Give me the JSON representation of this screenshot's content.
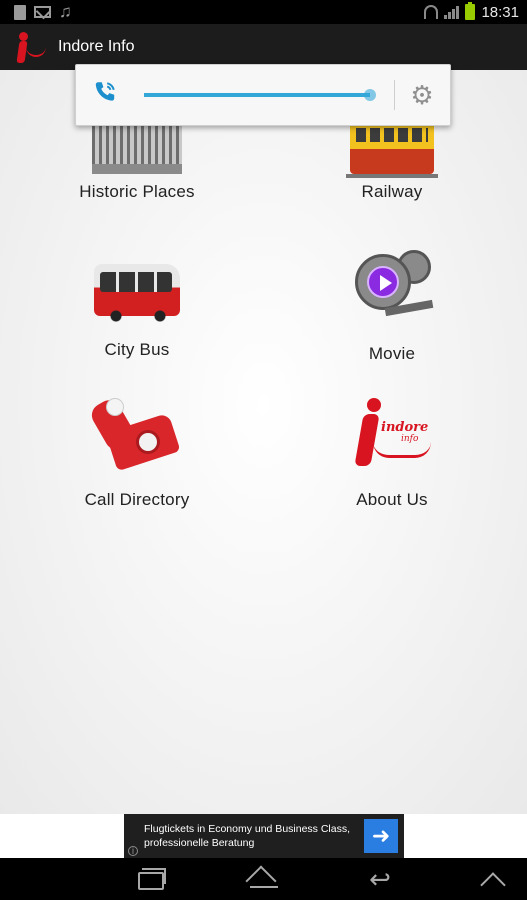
{
  "status_bar": {
    "time": "18:31",
    "left_icons": [
      "document-icon",
      "mail-icon",
      "music-icon"
    ],
    "right_icons": [
      "wifi-icon",
      "signal-icon",
      "battery-icon"
    ],
    "battery_color": "#99cc00"
  },
  "action_bar": {
    "title": "Indore Info",
    "logo_icon": "indore-info-logo",
    "background": "#1c1c1c"
  },
  "volume_popup": {
    "stream_icon": "call-volume-icon",
    "settings_icon": "gear-icon",
    "level": 1.0,
    "accent": "#33a7d8"
  },
  "tiles": [
    {
      "label": "Historic Places",
      "icon": "historic-places-icon"
    },
    {
      "label": "Railway",
      "icon": "railway-icon"
    },
    {
      "label": "City Bus",
      "icon": "city-bus-icon"
    },
    {
      "label": "Movie",
      "icon": "movie-icon"
    },
    {
      "label": "Call Directory",
      "icon": "call-directory-icon"
    },
    {
      "label": "About Us",
      "icon": "about-us-icon"
    }
  ],
  "about_logo": {
    "word": "indore",
    "sub": "info"
  },
  "ad": {
    "text": "Flugtickets in Economy und Business Class, professionelle Beratung",
    "info_glyph": "i",
    "arrow_glyph": "➜",
    "arrow_color": "#2a7de1"
  },
  "nav_bar": {
    "buttons": [
      "recents-icon",
      "home-icon",
      "back-icon",
      "menu-up-icon"
    ],
    "back_glyph": "↩"
  }
}
